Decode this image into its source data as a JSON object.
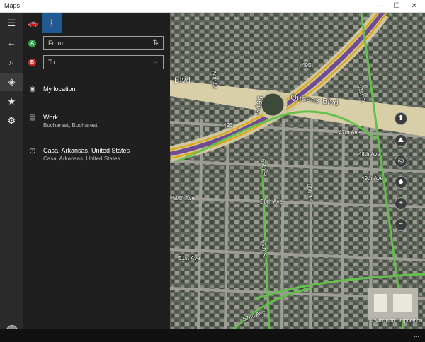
{
  "window": {
    "title": "Maps",
    "minimize": "—",
    "maximize": "☐",
    "close": "✕"
  },
  "rail": {
    "menu": "☰",
    "back": "←",
    "search": "⌕",
    "directions": "◈",
    "favorites": "★",
    "settings": "⚙"
  },
  "panel": {
    "mode_car": "🚗",
    "mode_walk": "🚶",
    "from_badge": "A",
    "to_badge": "B",
    "from_placeholder": "From",
    "to_placeholder": "To",
    "swap_icon": "⇅",
    "go_icon": "→",
    "items": [
      {
        "icon": "◉",
        "main": "My location",
        "sub": ""
      },
      {
        "icon": "▤",
        "main": "Work",
        "sub": "Bucharest, Bucharest"
      },
      {
        "icon": "◷",
        "main": "Casa, Arkansas, United States",
        "sub": "Casa, Arkansas, United States"
      }
    ]
  },
  "map": {
    "labels": {
      "blvd": "Blvd",
      "queens_blvd": "Queens Blvd",
      "i495": "I-495",
      "shield_a": "495",
      "shield_b": "495",
      "ave47": "47th Ave",
      "ave48": "48th Ave",
      "ave49": "49th Ave",
      "ave50_left": "50th Ave",
      "ave50_center": "50th Ave",
      "ave51": "51st Ave",
      "ave52": "52nd Ave",
      "st65": "65th St",
      "st65b": "65th St",
      "pl65": "65th Pl",
      "st61": "61st St",
      "st64": "64th St"
    },
    "controls": {
      "compass": "⬆",
      "tilt": "⛰",
      "locate": "◎",
      "layers": "◆",
      "zoom_in": "+",
      "zoom_out": "−"
    },
    "copyright": "© Microsoft Corporation"
  },
  "statusbar": {
    "more": "..."
  }
}
